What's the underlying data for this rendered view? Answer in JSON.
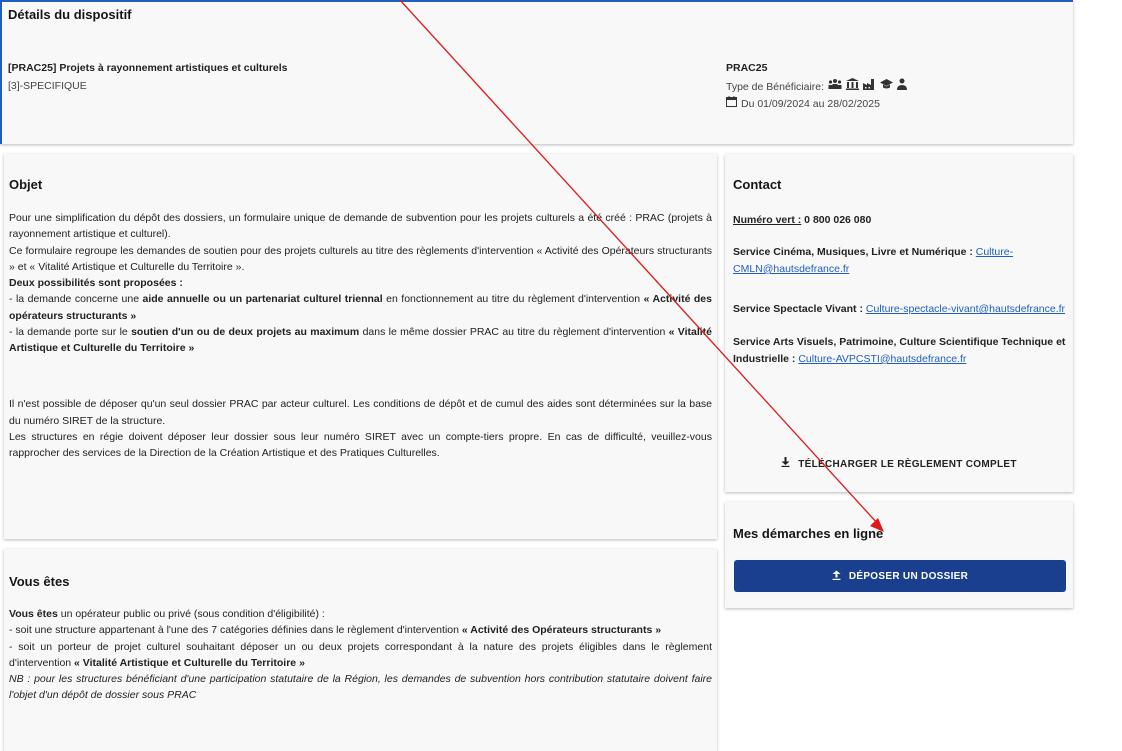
{
  "details": {
    "title": "Détails du dispositif",
    "dispositif_name": "[PRAC25] Projets à rayonnement artistiques et culturels",
    "dispositif_type": "[3]-SPECIFIQUE",
    "code": "PRAC25",
    "beneficiaire_label": "Type de Bénéficiaire:",
    "beneficiaire_icons": [
      "group-icon",
      "institution-icon",
      "factory-icon",
      "school-icon",
      "person-icon"
    ],
    "dates": "Du 01/09/2024 au 28/02/2025"
  },
  "objet": {
    "title": "Objet",
    "p1": "Pour une simplification du dépôt des dossiers, un formulaire unique de demande de subvention pour les projets culturels a été créé : PRAC (projets à rayonnement artistique et culturel).",
    "p2": "Ce formulaire regroupe les demandes de soutien pour des projets culturels au titre des règlements d'intervention « Activité des Opérateurs structurants » et « Vitalité Artistique et Culturelle du Territoire ».",
    "p3": "Deux possibilités sont proposées :",
    "b1_pre": "- la demande concerne une ",
    "b1_bold": "aide annuelle ou un partenariat culturel triennal",
    "b1_mid": " en fonctionnement au titre du règlement d'intervention ",
    "b1_bold2": "« Activité des opérateurs structurants »",
    "b2_pre": "- la demande porte sur le ",
    "b2_bold": "soutien d'un ou de deux projets au maximum",
    "b2_mid": " dans le même dossier PRAC au titre du règlement d'intervention ",
    "b2_bold2": "« Vitalité Artistique et Culturelle du Territoire »",
    "p4": "Il n'est possible de déposer qu'un seul dossier PRAC par acteur culturel. Les conditions de dépôt et de cumul des aides sont déterminées sur la base du numéro SIRET de la structure.",
    "p5": "Les structures en régie doivent déposer leur dossier sous leur numéro SIRET avec un compte-tiers propre. En cas de difficulté, veuillez-vous rapprocher des services de la Direction de la Création Artistique et des Pratiques Culturelles."
  },
  "vous": {
    "title": "Vous êtes",
    "intro_bold": "Vous êtes",
    "intro_rest": " un opérateur public ou privé (sous condition d'éligibilité) :",
    "l1_pre": " - soit une structure appartenant à l'une des 7 catégories définies dans le règlement d'intervention ",
    "l1_bold": "« Activité des Opérateurs structurants »",
    "l2_pre": " - soit un porteur de projet culturel souhaitant déposer un ou deux projets correspondant à la nature des projets éligibles dans le règlement d'intervention ",
    "l2_bold": "« Vitalité Artistique et Culturelle du Territoire »",
    "nb": "NB : pour les structures bénéficiant d'une participation statutaire de la Région, les demandes de subvention hors contribution statutaire doivent faire l'objet d'un dépôt de dossier sous PRAC"
  },
  "contact": {
    "title": "Contact",
    "numero_label": "Numéro vert :",
    "numero_value": " 0 800 026 080",
    "s1_label": "Service Cinéma, Musiques, Livre et Numérique : ",
    "s1_email": "Culture-CMLN@hautsdefrance.fr",
    "s2_label": "Service Spectacle Vivant : ",
    "s2_email": "Culture-spectacle-vivant@hautsdefrance.fr",
    "s3_label": "Service Arts Visuels, Patrimoine, Culture Scientifique Technique et Industrielle : ",
    "s3_email": "Culture-AVPCSTI@hautsdefrance.fr",
    "download_label": "TÉLÉCHARGER LE RÈGLEMENT COMPLET"
  },
  "demarches": {
    "title": "Mes démarches en ligne",
    "button_label": "DÉPOSER UN DOSSIER"
  },
  "colors": {
    "primary": "#1a3f8f",
    "link": "#1f5fbf",
    "annotation_arrow": "#e01818"
  }
}
